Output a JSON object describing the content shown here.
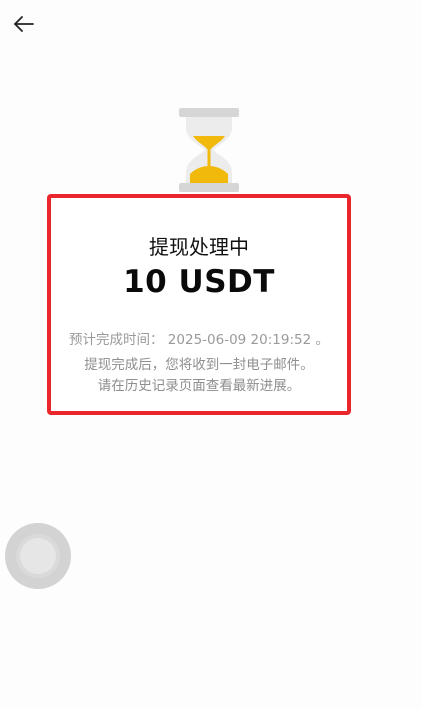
{
  "icons": {
    "back": "back-arrow-icon",
    "status": "hourglass-icon",
    "float": "assistive-touch-icon"
  },
  "colors": {
    "highlight_border": "#e8262b",
    "hourglass_sand": "#f0b90b",
    "background": "#fdfdfe"
  },
  "status": {
    "title": "提现处理中",
    "amount": "10 USDT",
    "eta_label": "预计完成时间：",
    "eta_value": "2025-06-09 20:19:52 。",
    "note_line1": "提现完成后，您将收到一封电子邮件。",
    "note_line2": "请在历史记录页面查看最新进展。"
  }
}
